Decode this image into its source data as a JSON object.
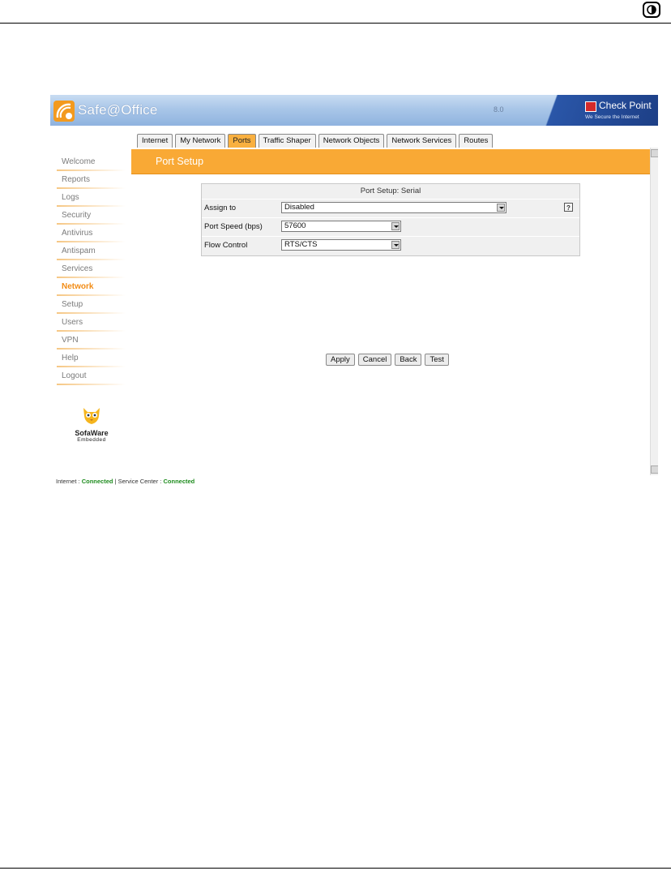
{
  "app": {
    "brand": "Safe@Office",
    "version": "8.0",
    "vendor": "Check Point",
    "vendor_tagline": "We Secure the Internet"
  },
  "tabs": [
    {
      "label": "Internet",
      "active": false
    },
    {
      "label": "My Network",
      "active": false
    },
    {
      "label": "Ports",
      "active": true
    },
    {
      "label": "Traffic Shaper",
      "active": false
    },
    {
      "label": "Network Objects",
      "active": false
    },
    {
      "label": "Network Services",
      "active": false
    },
    {
      "label": "Routes",
      "active": false
    }
  ],
  "sidebar": {
    "items": [
      {
        "label": "Welcome",
        "active": false
      },
      {
        "label": "Reports",
        "active": false
      },
      {
        "label": "Logs",
        "active": false
      },
      {
        "label": "Security",
        "active": false
      },
      {
        "label": "Antivirus",
        "active": false
      },
      {
        "label": "Antispam",
        "active": false
      },
      {
        "label": "Services",
        "active": false
      },
      {
        "label": "Network",
        "active": true
      },
      {
        "label": "Setup",
        "active": false
      },
      {
        "label": "Users",
        "active": false
      },
      {
        "label": "VPN",
        "active": false
      },
      {
        "label": "Help",
        "active": false
      },
      {
        "label": "Logout",
        "active": false
      }
    ],
    "footer_logo": {
      "name": "SofaWare",
      "subtitle": "Embedded"
    }
  },
  "page": {
    "section_title": "Port Setup",
    "form_title": "Port Setup: Serial",
    "fields": [
      {
        "label": "Assign to",
        "value": "Disabled"
      },
      {
        "label": "Port Speed (bps)",
        "value": "57600"
      },
      {
        "label": "Flow Control",
        "value": "RTS/CTS"
      }
    ],
    "help_icon_glyph": "?",
    "buttons": {
      "apply": "Apply",
      "cancel": "Cancel",
      "back": "Back",
      "test": "Test"
    }
  },
  "status": {
    "internet_label": "Internet :",
    "internet_value": "Connected",
    "service_center_label": "Service Center :",
    "service_center_value": "Connected"
  },
  "colors": {
    "accent_orange": "#f9a935",
    "banner_blue": "#a9c6e8",
    "active_nav": "#f28c16",
    "status_ok": "#1e8c1e"
  }
}
